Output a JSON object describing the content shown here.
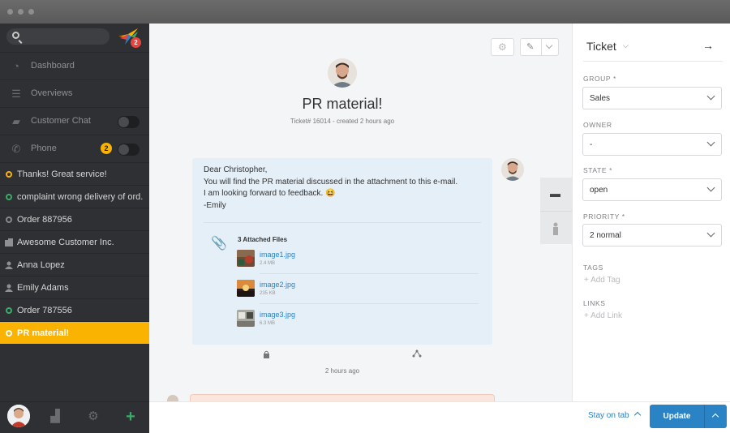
{
  "sidebar": {
    "notification_count": "2",
    "nav": [
      {
        "icon": "dashboard-icon",
        "label": "Dashboard"
      },
      {
        "icon": "overviews-icon",
        "label": "Overviews"
      },
      {
        "icon": "chat-icon",
        "label": "Customer Chat"
      },
      {
        "icon": "phone-icon",
        "label": "Phone",
        "badge": "2"
      }
    ],
    "tasks": [
      {
        "kind": "ticket",
        "label": "Thanks! Great service!",
        "status_color": "#f9b300"
      },
      {
        "kind": "ticket",
        "label": "complaint wrong delivery of ord...",
        "status_color": "#38ad69"
      },
      {
        "kind": "ticket",
        "label": "Order 887956",
        "status_color": "#888888"
      },
      {
        "kind": "organization",
        "label": "Awesome Customer Inc."
      },
      {
        "kind": "user",
        "label": "Anna Lopez"
      },
      {
        "kind": "user",
        "label": "Emily Adams"
      },
      {
        "kind": "ticket",
        "label": "Order 787556",
        "status_color": "#38ad69"
      },
      {
        "kind": "ticket",
        "label": "PR material!",
        "status_color": "#ffffff",
        "active": true
      }
    ]
  },
  "ticket": {
    "title": "PR material!",
    "meta": "Ticket# 16014 - created 2 hours ago",
    "message_lines": [
      "Dear Christopher,",
      "You will find the PR material discussed in the attachment to this e-mail.",
      "I am looking forward to feedback. 😆",
      "-Emily"
    ],
    "attachments_title": "3 Attached Files",
    "attachments": [
      {
        "name": "image1.jpg",
        "size": "2.4 MB"
      },
      {
        "name": "image2.jpg",
        "size": "235 KB"
      },
      {
        "name": "image3.jpg",
        "size": "6.3 MB"
      }
    ],
    "time_ago": "2 hours ago"
  },
  "panel": {
    "title": "Ticket",
    "group_label": "GROUP *",
    "group_value": "Sales",
    "owner_label": "OWNER",
    "owner_value": "-",
    "state_label": "STATE *",
    "state_value": "open",
    "priority_label": "PRIORITY *",
    "priority_value": "2 normal",
    "tags_label": "TAGS",
    "add_tag": "+ Add Tag",
    "links_label": "LINKS",
    "add_link": "+ Add Link"
  },
  "footer": {
    "stay_on_tab": "Stay on tab",
    "update": "Update"
  },
  "colors": {
    "accent": "#f9b300",
    "primary": "#2a83c4",
    "sidebar_bg": "#2f3033"
  }
}
